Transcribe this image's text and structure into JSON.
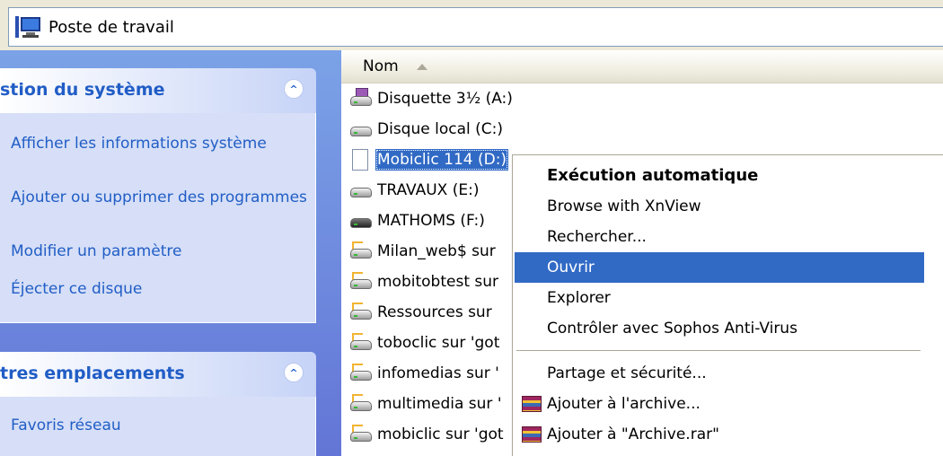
{
  "address_bar": {
    "icon": "computer-icon",
    "title": "Poste de travail"
  },
  "task_pane": {
    "system_panel": {
      "title": "stion du système",
      "links": [
        "Afficher les informations système",
        "Ajouter ou supprimer des programmes",
        "Modifier un paramètre",
        "Éjecter ce disque"
      ]
    },
    "other_places_panel": {
      "title": "tres emplacements",
      "links": [
        "Favoris réseau"
      ]
    }
  },
  "file_list": {
    "column_header": "Nom",
    "items": [
      {
        "label": "Disquette 3½ (A:)",
        "icon": "floppy-drive-icon"
      },
      {
        "label": "Disque local (C:)",
        "icon": "hard-drive-icon"
      },
      {
        "label": "Mobiclic 114 (D:)",
        "icon": "cd-drive-icon",
        "selected": true
      },
      {
        "label": "TRAVAUX (E:)",
        "icon": "hard-drive-icon"
      },
      {
        "label": "MATHOMS (F:)",
        "icon": "hard-drive-icon"
      },
      {
        "label": "Milan_web$ sur",
        "icon": "network-drive-icon"
      },
      {
        "label": "mobitobtest sur",
        "icon": "network-drive-icon"
      },
      {
        "label": "Ressources sur",
        "icon": "network-drive-icon"
      },
      {
        "label": "toboclic sur 'got",
        "icon": "network-drive-icon"
      },
      {
        "label": "infomedias sur '",
        "icon": "network-drive-icon"
      },
      {
        "label": "multimedia sur '",
        "icon": "network-drive-icon"
      },
      {
        "label": "mobiclic sur 'got",
        "icon": "network-drive-icon"
      }
    ]
  },
  "context_menu": {
    "items": [
      {
        "label": "Exécution automatique",
        "default": true
      },
      {
        "label": "Browse with XnView"
      },
      {
        "label": "Rechercher..."
      },
      {
        "label": "Ouvrir",
        "highlighted": true
      },
      {
        "label": "Explorer"
      },
      {
        "label": "Contrôler avec Sophos Anti-Virus"
      },
      {
        "label": "Partage et sécurité..."
      },
      {
        "label": "Ajouter à l'archive...",
        "icon": "winrar-icon"
      },
      {
        "label": "Ajouter à \"Archive.rar\"",
        "icon": "winrar-icon"
      }
    ]
  },
  "colors": {
    "selection": "#316ac5",
    "link": "#215dc6",
    "pane": "#7ba2e7"
  }
}
